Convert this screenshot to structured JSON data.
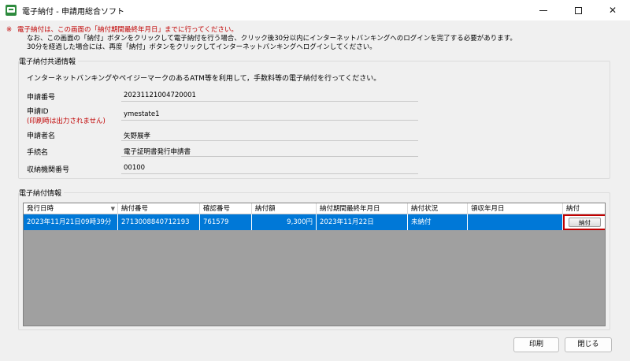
{
  "window": {
    "title": "電子納付 - 申請用総合ソフト"
  },
  "notice": {
    "mark": "※",
    "line1": "電子納付は、この画面の「納付期間最終年月日」までに行ってください。",
    "line2": "なお、この画面の「納付」ボタンをクリックして電子納付を行う場合、クリック後30分以内にインターネットバンキングへのログインを完了する必要があります。",
    "line3": "30分を経過した場合には、再度「納付」ボタンをクリックしてインターネットバンキングへログインしてください。"
  },
  "common": {
    "label": "電子納付共通情報",
    "description": "インターネットバンキングやペイジーマークのあるATM等を利用して，手数料等の電子納付を行ってください。",
    "fields": [
      {
        "label": "申請番号",
        "sub": "",
        "value": "20231121004720001"
      },
      {
        "label": "申請ID",
        "sub": "(印刷時は出力されません)",
        "value": "ymestate1"
      },
      {
        "label": "申請者名",
        "sub": "",
        "value": "矢野展孝"
      },
      {
        "label": "手続名",
        "sub": "",
        "value": "電子証明書発行申請書"
      },
      {
        "label": "収納機関番号",
        "sub": "",
        "value": "00100"
      }
    ]
  },
  "payment": {
    "label": "電子納付情報",
    "columns": [
      "発行日時",
      "納付番号",
      "確認番号",
      "納付額",
      "納付期間最終年月日",
      "納付状況",
      "領収年月日",
      "納付"
    ],
    "rows": [
      {
        "issued": "2023年11月21日09時39分",
        "payment_no": "2713008840712193",
        "confirm_no": "761579",
        "amount": "9,300円",
        "deadline": "2023年11月22日",
        "status": "未納付",
        "receipt_date": "",
        "button": "納付"
      }
    ]
  },
  "footer": {
    "print": "印刷",
    "close": "閉じる"
  }
}
